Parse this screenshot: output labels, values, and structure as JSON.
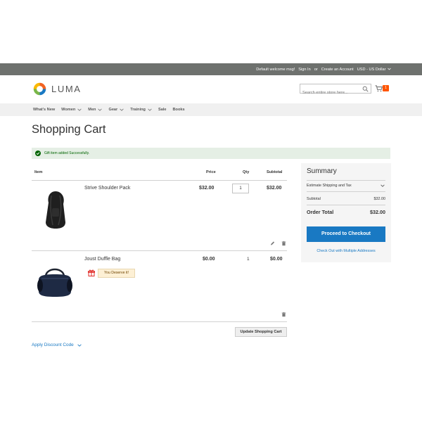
{
  "topbar": {
    "welcome": "Default welcome msg!",
    "sign_in": "Sign In",
    "or": "or",
    "create_account": "Create an Account",
    "currency": "USD - US Dollar"
  },
  "header": {
    "logo_text": "LUMA",
    "search_placeholder": "Search entire store here...",
    "cart_count": "1"
  },
  "nav": {
    "items": [
      {
        "label": "What's New"
      },
      {
        "label": "Women"
      },
      {
        "label": "Men"
      },
      {
        "label": "Gear"
      },
      {
        "label": "Training"
      },
      {
        "label": "Sale"
      },
      {
        "label": "Books"
      }
    ]
  },
  "page": {
    "title": "Shopping Cart",
    "message": "Gift item added Successfully."
  },
  "cart": {
    "headers": {
      "item": "Item",
      "price": "Price",
      "qty": "Qty",
      "subtotal": "Subtotal"
    },
    "items": [
      {
        "name": "Strive Shoulder Pack",
        "price": "$32.00",
        "qty": "1",
        "subtotal": "$32.00"
      },
      {
        "name": "Joust Duffle Bag",
        "price": "$0.00",
        "qty": "1",
        "subtotal": "$0.00",
        "badge": "You Deserve it!"
      }
    ],
    "update_label": "Update Shopping Cart",
    "discount_label": "Apply Discount Code"
  },
  "summary": {
    "title": "Summary",
    "estimate_label": "Estimate Shipping and Tax",
    "subtotal_label": "Subtotal",
    "subtotal_value": "$32.00",
    "total_label": "Order Total",
    "total_value": "$32.00",
    "checkout_label": "Proceed to Checkout",
    "multi_label": "Check Out with Multiple Addresses"
  },
  "colors": {
    "accent": "#1979c3",
    "cart_badge": "#ff5501",
    "topbar": "#6e716e",
    "success_bg": "#e5efe5"
  },
  "icons": [
    "search-icon",
    "cart-icon",
    "chevron-down-icon",
    "check-circle-icon",
    "edit-icon",
    "trash-icon",
    "gift-icon"
  ]
}
